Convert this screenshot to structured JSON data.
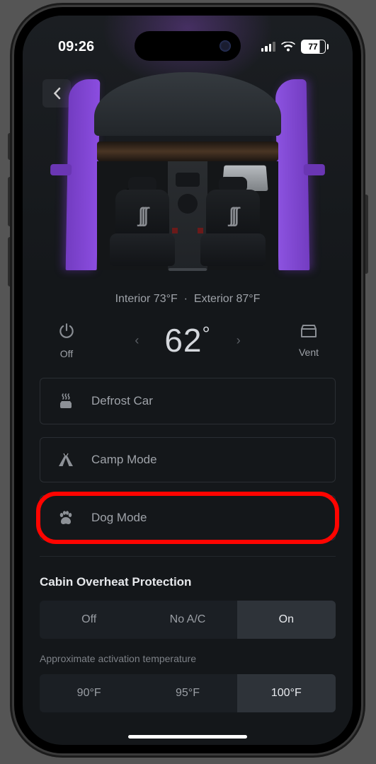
{
  "status": {
    "time": "09:26",
    "battery": "77"
  },
  "temps": {
    "interior_label": "Interior 73°F",
    "sep": "·",
    "exterior_label": "Exterior 87°F"
  },
  "climate": {
    "off_label": "Off",
    "vent_label": "Vent",
    "set_temp": "62",
    "deg": "°"
  },
  "options": {
    "defrost": "Defrost Car",
    "camp": "Camp Mode",
    "dog": "Dog Mode"
  },
  "overheat": {
    "title": "Cabin Overheat Protection",
    "seg": {
      "off": "Off",
      "noac": "No A/C",
      "on": "On"
    },
    "approx_label": "Approximate activation temperature",
    "temps": {
      "t90": "90°F",
      "t95": "95°F",
      "t100": "100°F"
    }
  }
}
